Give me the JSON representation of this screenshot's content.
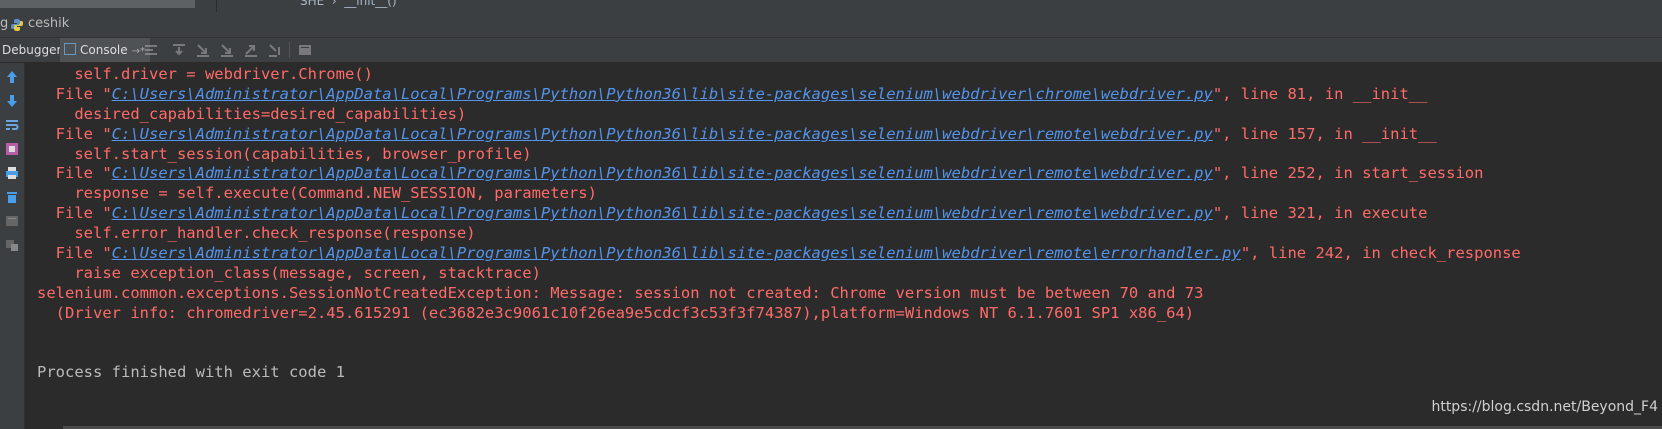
{
  "top": {
    "crumb": "SHE  ›  __init__()"
  },
  "run_bar": {
    "prefix": "g",
    "title": "ceshik"
  },
  "toolbar": {
    "debugger_label": "Debugger",
    "console_label": "Console",
    "pin_glyph": "→*"
  },
  "console": {
    "lines": [
      {
        "kind": "err",
        "text": "    self.driver = webdriver.Chrome()"
      },
      {
        "kind": "file",
        "pre": "  File \"",
        "path": "C:\\Users\\Administrator\\AppData\\Local\\Programs\\Python\\Python36\\lib\\site-packages\\selenium\\webdriver\\chrome\\webdriver.py",
        "post": "\", line 81, in __init__"
      },
      {
        "kind": "err",
        "text": "    desired_capabilities=desired_capabilities)"
      },
      {
        "kind": "file",
        "pre": "  File \"",
        "path": "C:\\Users\\Administrator\\AppData\\Local\\Programs\\Python\\Python36\\lib\\site-packages\\selenium\\webdriver\\remote\\webdriver.py",
        "post": "\", line 157, in __init__"
      },
      {
        "kind": "err",
        "text": "    self.start_session(capabilities, browser_profile)"
      },
      {
        "kind": "file",
        "pre": "  File \"",
        "path": "C:\\Users\\Administrator\\AppData\\Local\\Programs\\Python\\Python36\\lib\\site-packages\\selenium\\webdriver\\remote\\webdriver.py",
        "post": "\", line 252, in start_session"
      },
      {
        "kind": "err",
        "text": "    response = self.execute(Command.NEW_SESSION, parameters)"
      },
      {
        "kind": "file",
        "pre": "  File \"",
        "path": "C:\\Users\\Administrator\\AppData\\Local\\Programs\\Python\\Python36\\lib\\site-packages\\selenium\\webdriver\\remote\\webdriver.py",
        "post": "\", line 321, in execute"
      },
      {
        "kind": "err",
        "text": "    self.error_handler.check_response(response)"
      },
      {
        "kind": "file",
        "pre": "  File \"",
        "path": "C:\\Users\\Administrator\\AppData\\Local\\Programs\\Python\\Python36\\lib\\site-packages\\selenium\\webdriver\\remote\\errorhandler.py",
        "post": "\", line 242, in check_response"
      },
      {
        "kind": "err",
        "text": "    raise exception_class(message, screen, stacktrace)"
      },
      {
        "kind": "err",
        "text": "selenium.common.exceptions.SessionNotCreatedException: Message: session not created: Chrome version must be between 70 and 73"
      },
      {
        "kind": "err",
        "text": "  (Driver info: chromedriver=2.45.615291 (ec3682e3c9061c10f26ea9e5cdcf3c53f3f74387),platform=Windows NT 6.1.7601 SP1 x86_64)"
      },
      {
        "kind": "err",
        "text": ""
      },
      {
        "kind": "err",
        "text": ""
      },
      {
        "kind": "normal",
        "text": "Process finished with exit code 1"
      }
    ]
  },
  "watermark": "https://blog.csdn.net/Beyond_F4",
  "colors": {
    "error": "#ff6b68",
    "link": "#5394ec",
    "normal": "#bbbbbb",
    "background": "#2b2b2b",
    "panel": "#3c3f41"
  }
}
